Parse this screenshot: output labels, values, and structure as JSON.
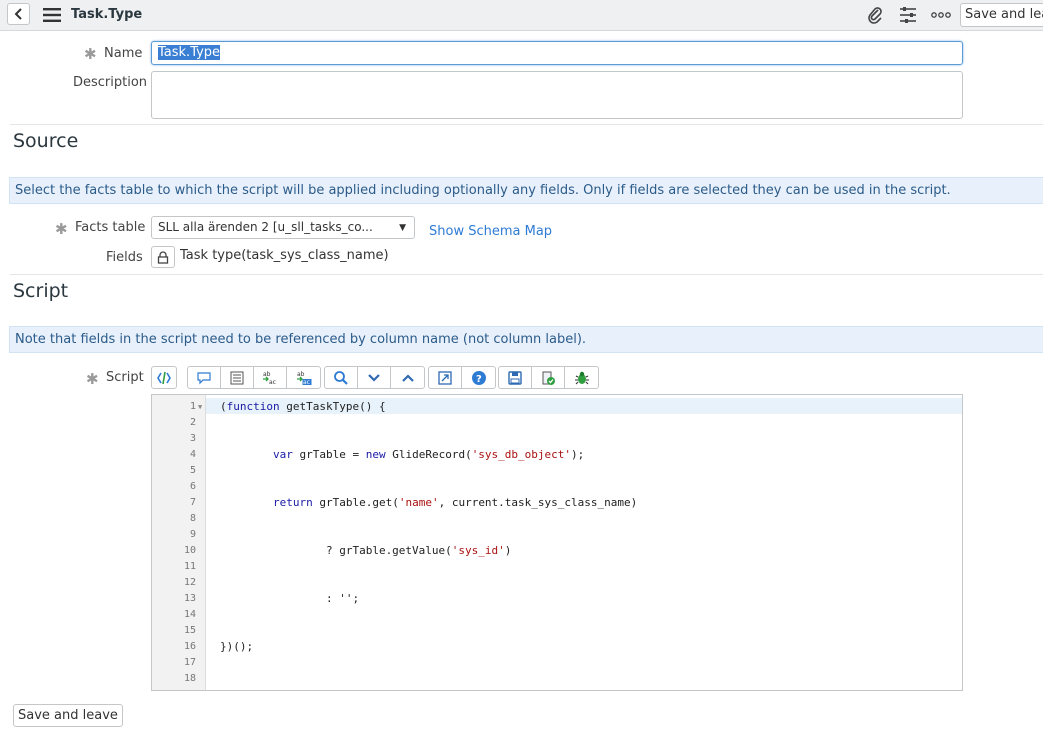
{
  "header": {
    "title": "Task.Type",
    "save_label": "Save and leave",
    "icons": [
      "back-icon",
      "hamburger-icon",
      "paperclip-icon",
      "sliders-icon",
      "more-icon"
    ]
  },
  "form": {
    "name_label": "Name",
    "name_value": "Task.Type",
    "description_label": "Description",
    "description_value": ""
  },
  "source": {
    "title": "Source",
    "info": "Select the facts table to which the script will be applied including optionally any fields. Only if fields are selected they can be used in the script.",
    "facts_label": "Facts table",
    "facts_value": "SLL alla ärenden 2 [u_sll_tasks_co...",
    "schema_link": "Show Schema Map",
    "fields_label": "Fields",
    "fields_value": "Task type(task_sys_class_name)"
  },
  "script": {
    "title": "Script",
    "info": "Note that fields in the script need to be referenced by column name (not column label).",
    "label": "Script",
    "toolbar_icons": [
      "toggle-syntax-icon",
      "comment-icon",
      "format-icon",
      "replace-icon",
      "replace-all-icon",
      "search-icon",
      "find-next-icon",
      "find-previous-icon",
      "fullscreen-icon",
      "help-icon",
      "save-icon",
      "script-debugger-icon",
      "debug-icon"
    ],
    "lines": [
      "(function getTaskType() {",
      "",
      "",
      "        var grTable = new GlideRecord('sys_db_object');",
      "",
      "",
      "        return grTable.get('name', current.task_sys_class_name)",
      "",
      "",
      "                ? grTable.getValue('sys_id')",
      "",
      "",
      "                : '';",
      "",
      "",
      "})();",
      "",
      ""
    ]
  },
  "footer": {
    "save_label": "Save and leave"
  },
  "colors": {
    "accent": "#2e7bd4",
    "info_bg": "#e8f1fb",
    "header_bg": "#eef0f1"
  }
}
